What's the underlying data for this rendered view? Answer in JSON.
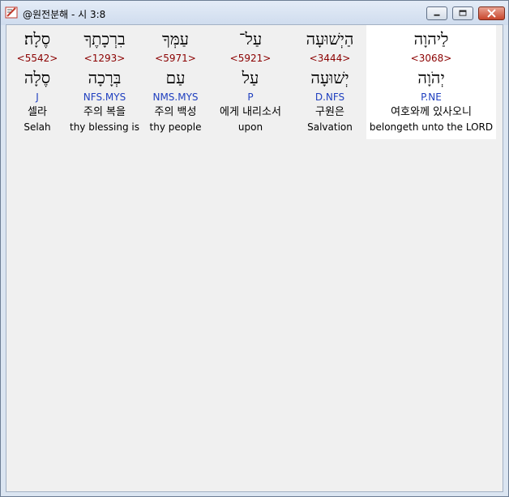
{
  "window": {
    "title": "@원전분해 - 시 3:8"
  },
  "words": [
    {
      "hebrew": "לַיהוָה",
      "strong": "<3068>",
      "lemma": "יְהֹוָה",
      "morph": "P.NE",
      "korean": "여호와께 있사오니",
      "english": "belongeth unto the LORD",
      "highlighted": true
    },
    {
      "hebrew": "הַיְשׁוּעָה",
      "strong": "<3444>",
      "lemma": "יְשׁוּעָה",
      "morph": "D.NFS",
      "korean": "구원은",
      "english": "Salvation",
      "highlighted": false
    },
    {
      "hebrew": "עַל־",
      "strong": "<5921>",
      "lemma": "עַל",
      "morph": "P",
      "korean": "에게 내리소서",
      "english": "upon",
      "highlighted": false
    },
    {
      "hebrew": "עַמְּךָ",
      "strong": "<5971>",
      "lemma": "עַם",
      "morph": "NMS.MYS",
      "korean": "주의 백성",
      "english": "thy people",
      "highlighted": false
    },
    {
      "hebrew": "בִרְכָתֶךָ",
      "strong": "<1293>",
      "lemma": "בְּרָכָה",
      "morph": "NFS.MYS",
      "korean": "주의 복을",
      "english": "thy blessing is",
      "highlighted": false
    },
    {
      "hebrew": "סֶלָה׃",
      "strong": "<5542>",
      "lemma": "סֶלָה",
      "morph": "J",
      "korean": "셀라",
      "english": "Selah",
      "highlighted": false
    }
  ]
}
